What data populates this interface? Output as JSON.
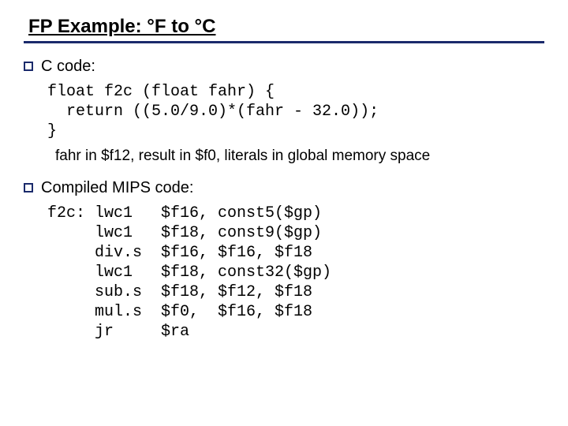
{
  "title": "FP Example: °F to °C",
  "section1": {
    "label": "C code:",
    "code": "float f2c (float fahr) {\n  return ((5.0/9.0)*(fahr - 32.0));\n}",
    "note": "fahr in $f12, result in $f0, literals in global memory space"
  },
  "section2": {
    "label": "Compiled MIPS code:",
    "code": "f2c: lwc1   $f16, const5($gp)\n     lwc1   $f18, const9($gp)\n     div.s  $f16, $f16, $f18\n     lwc1   $f18, const32($gp)\n     sub.s  $f18, $f12, $f18\n     mul.s  $f0,  $f16, $f18\n     jr     $ra"
  }
}
